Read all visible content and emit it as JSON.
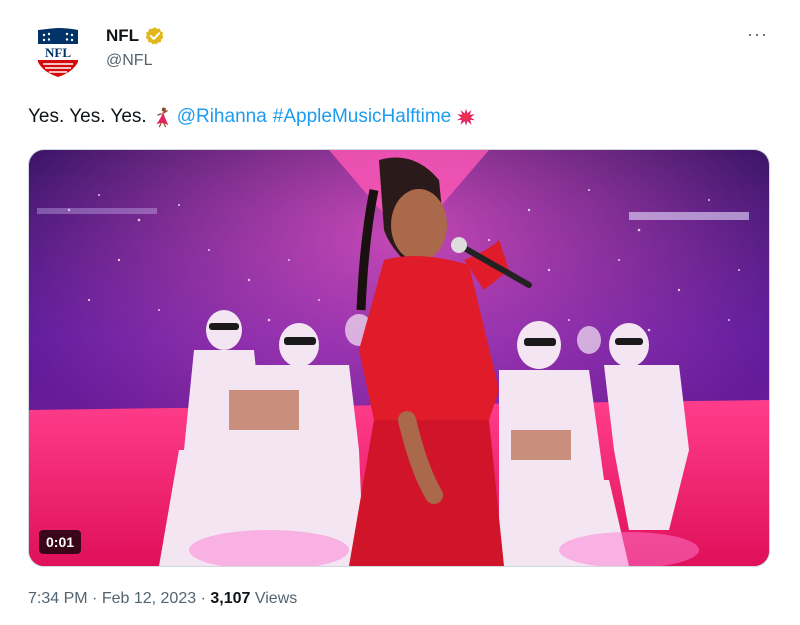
{
  "author": {
    "display_name": "NFL",
    "handle": "@NFL",
    "verified_badge": "verified-badge-icon",
    "avatar_logo_text": "NFL",
    "verified_color": "#e2b719"
  },
  "more_label": "···",
  "tweet": {
    "text_plain": "Yes. Yes. Yes.",
    "mention": "@Rihanna",
    "hashtag": "#AppleMusicHalftime",
    "emoji_1": "dancer-emoji",
    "emoji_2": "red-splat-emoji",
    "link_color": "#1d9bf0"
  },
  "media": {
    "type": "video",
    "timestamp": "0:01"
  },
  "meta": {
    "time": "7:34 PM",
    "separator": "·",
    "date": "Feb 12, 2023",
    "views_count": "3,107",
    "views_label": "Views"
  }
}
